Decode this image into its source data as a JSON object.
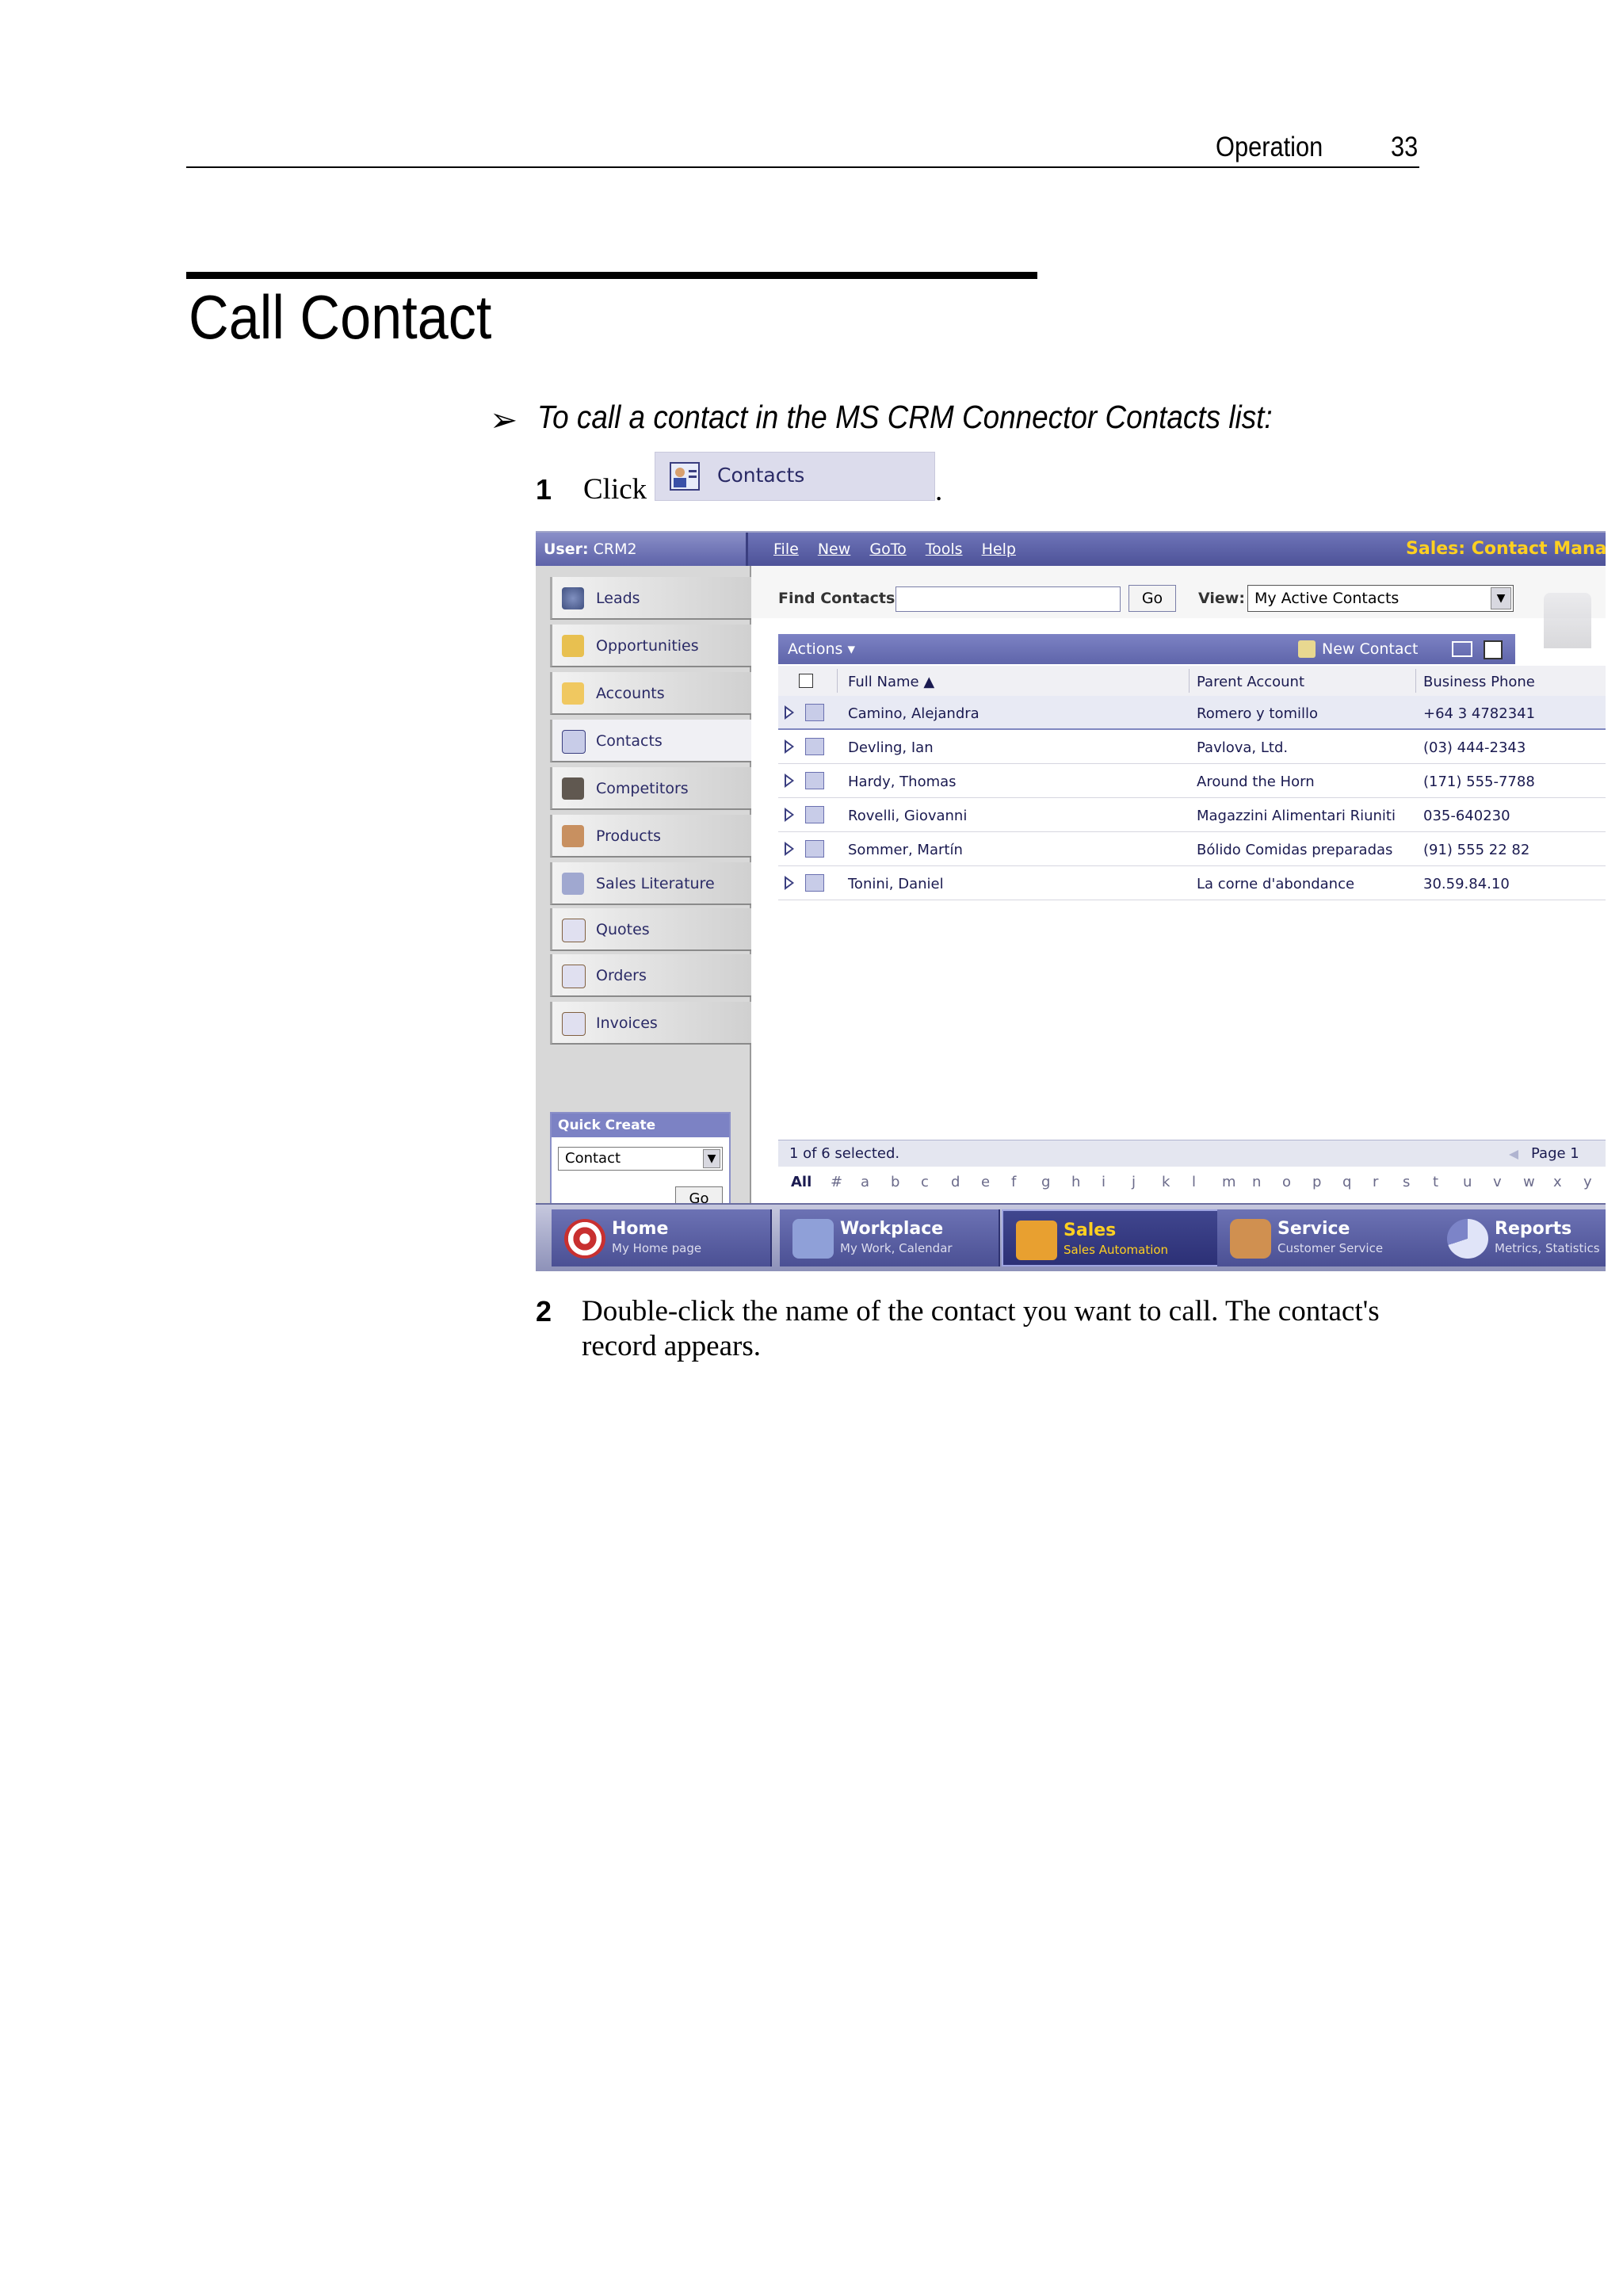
{
  "header": {
    "section": "Operation",
    "page_number": "33"
  },
  "title": "Call Contact",
  "procedure": {
    "bullet": "➢",
    "text": "To call a contact in the MS CRM Connector Contacts list:"
  },
  "steps": [
    {
      "num": "1",
      "text": "Click",
      "button_label": "Contacts",
      "suffix": "."
    },
    {
      "num": "2",
      "text": "Double-click the name of the contact you want to call. The contact's record appears."
    }
  ],
  "app": {
    "user_label": "User:",
    "user_value": "CRM2",
    "menu": [
      "File",
      "New",
      "GoTo",
      "Tools",
      "Help"
    ],
    "title": "Sales: Contact Manager",
    "nav": [
      "Leads",
      "Opportunities",
      "Accounts",
      "Contacts",
      "Competitors",
      "Products",
      "Sales Literature",
      "Quotes",
      "Orders",
      "Invoices"
    ],
    "nav_selected": "Contacts",
    "quick_create": {
      "title": "Quick Create",
      "value": "Contact",
      "go": "Go"
    },
    "find": {
      "label": "Find Contacts:",
      "value": "",
      "go": "Go"
    },
    "view": {
      "label": "View:",
      "value": "My Active Contacts"
    },
    "actions": {
      "label": "Actions ▾",
      "new_contact": "New Contact"
    },
    "columns": [
      "Full Name ▲",
      "Parent Account",
      "Business Phone"
    ],
    "rows": [
      [
        "Camino, Alejandra",
        "Romero y tomillo",
        "+64 3 4782341"
      ],
      [
        "Devling, Ian",
        "Pavlova, Ltd.",
        "(03) 444-2343"
      ],
      [
        "Hardy, Thomas",
        "Around the Horn",
        "(171) 555-7788"
      ],
      [
        "Rovelli, Giovanni",
        "Magazzini Alimentari Riuniti",
        "035-640230"
      ],
      [
        "Sommer, Martín",
        "Bólido Comidas preparadas",
        "(91) 555 22 82"
      ],
      [
        "Tonini, Daniel",
        "La corne d'abondance",
        "30.59.84.10"
      ]
    ],
    "status": "1 of 6 selected.",
    "page": "Page 1",
    "alphabet": [
      "All",
      "#",
      "a",
      "b",
      "c",
      "d",
      "e",
      "f",
      "g",
      "h",
      "i",
      "j",
      "k",
      "l",
      "m",
      "n",
      "o",
      "p",
      "q",
      "r",
      "s",
      "t",
      "u",
      "v",
      "w",
      "x",
      "y"
    ],
    "bottom_tabs": [
      {
        "title": "Home",
        "sub": "My Home page"
      },
      {
        "title": "Workplace",
        "sub": "My Work, Calendar"
      },
      {
        "title": "Sales",
        "sub": "Sales Automation"
      },
      {
        "title": "Service",
        "sub": "Customer Service"
      },
      {
        "title": "Reports",
        "sub": "Metrics, Statistics"
      }
    ],
    "selected_tab": "Sales"
  }
}
